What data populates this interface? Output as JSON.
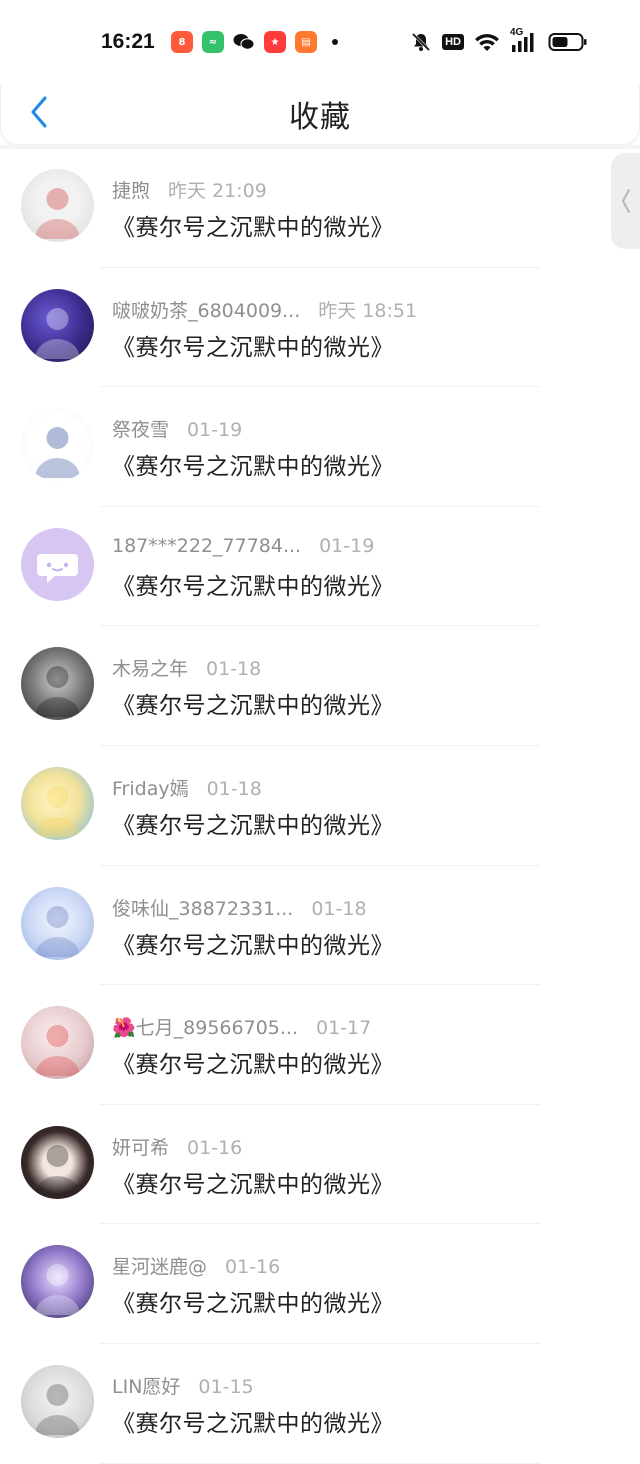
{
  "status_bar": {
    "time": "16:21",
    "app_icons": [
      {
        "name": "app-icon-1",
        "color": "#ff5a3c",
        "glyph": "8"
      },
      {
        "name": "app-icon-2",
        "color": "#33c26b",
        "glyph": "≈"
      },
      {
        "name": "wechat-icon",
        "color": "#ffffff",
        "glyph": "●"
      },
      {
        "name": "app-icon-4",
        "color": "#ff3b3b",
        "glyph": "★"
      },
      {
        "name": "book-app-icon",
        "color": "#ff7a30",
        "glyph": "▤"
      }
    ],
    "hd_label": "HD",
    "network_label": "4G"
  },
  "header": {
    "title": "收藏",
    "back_icon": "chevron-left-icon",
    "accent": "#1e88e5"
  },
  "items": [
    {
      "name": "捷煦",
      "time": "昨天 21:09",
      "book": "《赛尔号之沉默中的微光》",
      "avatar_bg": "radial-gradient(circle at 50% 45%, #f2f2f2 0 40%, #d9d9d9 100%)",
      "avatar_fg": "#c33"
    },
    {
      "name": "啵啵奶茶_6804009...",
      "time": "昨天 18:51",
      "book": "《赛尔号之沉默中的微光》",
      "avatar_bg": "radial-gradient(circle at 40% 40%, #6a5bd6 0%, #3b2a8a 55%, #1b1746 100%)",
      "avatar_fg": "#fff"
    },
    {
      "name": "祭夜雪",
      "time": "01-19",
      "book": "《赛尔号之沉默中的微光》",
      "avatar_bg": "radial-gradient(circle at 50% 50%, #ffffff 0 55%, #f3f3f3 100%)",
      "avatar_fg": "#1e3c8c"
    },
    {
      "name": "187***222_77784...",
      "time": "01-19",
      "book": "《赛尔号之沉默中的微光》",
      "avatar_bg": "#d8c6f2",
      "avatar_fg": "#ffffff"
    },
    {
      "name": "木易之年",
      "time": "01-18",
      "book": "《赛尔号之沉默中的微光》",
      "avatar_bg": "radial-gradient(circle at 50% 45%, #cfcfcf 0%, #777 50%, #2a2a2a 100%)",
      "avatar_fg": "#111"
    },
    {
      "name": "Friday嫣",
      "time": "01-18",
      "book": "《赛尔号之沉默中的微光》",
      "avatar_bg": "radial-gradient(circle at 45% 45%, #fff6c8 0%, #f3e29a 45%, #6cb6e8 100%)",
      "avatar_fg": "#f5d35a"
    },
    {
      "name": "俊味仙_38872331...",
      "time": "01-18",
      "book": "《赛尔号之沉默中的微光》",
      "avatar_bg": "radial-gradient(circle at 50% 45%, #f4f7ff 0%, #c9d6f4 55%, #8ea8dc 100%)",
      "avatar_fg": "#5a74b8"
    },
    {
      "name": "🌺七月_89566705...",
      "time": "01-17",
      "book": "《赛尔号之沉默中的微光》",
      "avatar_bg": "radial-gradient(circle at 45% 40%, #fbeff0 0%, #e6c9cc 55%, #b48b8f 100%)",
      "avatar_fg": "#d33"
    },
    {
      "name": "妍可希",
      "time": "01-16",
      "book": "《赛尔号之沉默中的微光》",
      "avatar_bg": "radial-gradient(circle at 50% 50%, #f3e5df 0 28%, #3a2a2a 60%, #111 100%)",
      "avatar_fg": "#222"
    },
    {
      "name": "星河迷鹿@",
      "time": "01-16",
      "book": "《赛尔号之沉默中的微光》",
      "avatar_bg": "radial-gradient(circle at 50% 45%, #e9dcff 0%, #8f78c8 50%, #2a2150 100%)",
      "avatar_fg": "#fff"
    },
    {
      "name": "LIN愿好",
      "time": "01-15",
      "book": "《赛尔号之沉默中的微光》",
      "avatar_bg": "radial-gradient(circle at 50% 45%, #f6f6f6 0%, #d8d8d8 60%, #a8a8a8 100%)",
      "avatar_fg": "#444"
    }
  ]
}
